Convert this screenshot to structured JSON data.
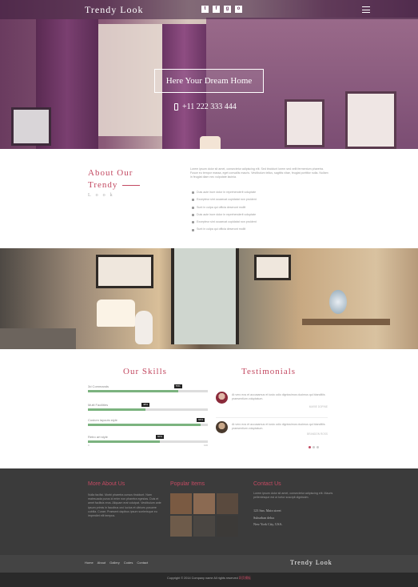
{
  "header": {
    "brand": "Trendy Look",
    "social_icons": [
      "twitter-icon",
      "facebook-icon",
      "google-plus-icon",
      "dribbble-icon"
    ],
    "social_glyphs": [
      "t",
      "f",
      "g",
      "o"
    ]
  },
  "hero": {
    "cta": "Here Your Dream Home",
    "phone": "+11 222 333 444"
  },
  "about": {
    "title_line1": "About Our",
    "title_line2": "Trendy",
    "subtitle": "Look",
    "text": "Lorem ipsum dolor sit amet, consectetur adipiscing elit. Sed tincidunt lorem sed velit fermentum pharetra. Fusce eu tempor massa, eget convallis mauris. Vestibulum tellus, sagittis vitae, feugiat porttitor nulla. Nullam in feugiat diam nec vulputate lacinia.",
    "list": [
      "Duis aute irure dolor in reprehenderit voluptate",
      "Excepteur sint occaecat cupidatat non proident",
      "Sunt in culpa qui officia deserunt mollit",
      "Duis aute irure dolor in reprehenderit voluptate",
      "Excepteur sint occaecat cupidatat non proident",
      "Sunt in culpa qui officia deserunt mollit"
    ]
  },
  "skills": {
    "title": "Our Skills",
    "items": [
      {
        "label": "3d Commands",
        "percent": 75,
        "tip": "75%"
      },
      {
        "label": "Multi Facilities",
        "percent": 48,
        "tip": "48%"
      },
      {
        "label": "Custom layouts style",
        "percent": 94,
        "tip": "94%"
      },
      {
        "label": "Retro art style",
        "percent": 60,
        "tip": "60%"
      }
    ],
    "scale_start": "0",
    "scale_end": "100"
  },
  "testimonials": {
    "title": "Testimonials",
    "items": [
      {
        "quote": "At vero eos et accusamus et iusto odio dignissimos ducimus qui blanditiis praesentium voluptatum.",
        "author": "MARIE DOPINE"
      },
      {
        "quote": "At vero eos et accusamus et iusto odio dignissimos ducimus qui blanditiis praesentium voluptatum.",
        "author": "BRANDON ROSS"
      }
    ]
  },
  "footer": {
    "more_title": "More About Us",
    "more_text": "Nulla facilisi. Morbi pharetra cursus tincidunt. Nam malesuada purus id enim non pharetra egestas. Duis et amet facilisis eros. Aliquam erat volutpat. Vestibulum ante ipsum primis in faucibus orci luctus et ultrices posuere cubilia. Curae; Praesent dapibus ipsum scelerisque eu imperdiet elit tempus.",
    "popular_title": "Popular Items",
    "contact_title": "Contact Us",
    "contact_text": "Lorem ipsum dolor sit amet, consectetur adipiscing elit. Mauris pellentesque est ut tortor suscipit dignissim.",
    "contact_lines": [
      "123 San. Main street",
      "Suburban delux",
      "New York City, USA."
    ],
    "nav": [
      "Home",
      "About",
      "Gallery",
      "Codes",
      "Contact"
    ],
    "brand": "Trendy Look",
    "copyright": "Copyright © 2014 Company name All rights reserved",
    "copyright_link": "网页模板"
  }
}
